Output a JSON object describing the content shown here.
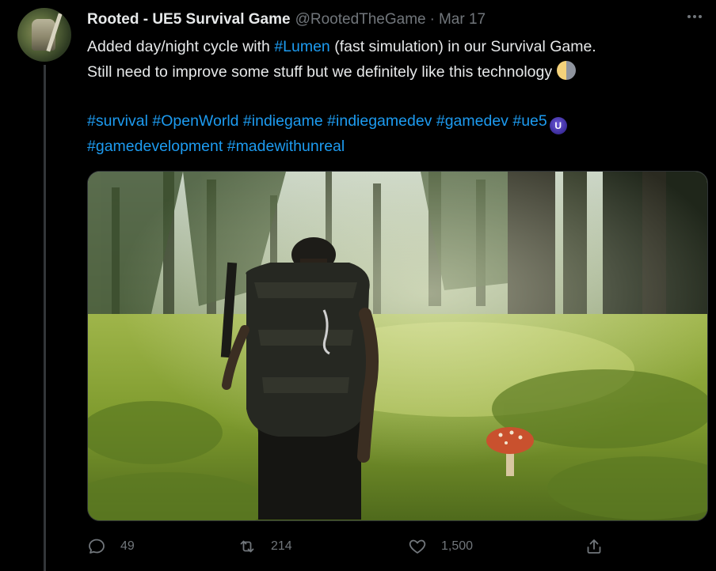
{
  "tweet": {
    "author_name": "Rooted - UE5 Survival Game",
    "handle": "@RootedTheGame",
    "separator": "·",
    "date": "Mar 17",
    "text_line1_before": "Added day/night cycle with ",
    "text_line1_tag": "#Lumen",
    "text_line1_after": " (fast simulation) in our Survival Game.",
    "text_line2": "Still need to improve some stuff but we definitely like this technology",
    "hashtags_line1": [
      "#survival",
      "#OpenWorld",
      "#indiegame",
      "#indiegamedev",
      "#gamedev",
      "#ue5"
    ],
    "hashtags_line2": [
      "#gamedevelopment",
      "#madewithunreal"
    ],
    "moon_emoji": "half-moon-emoji",
    "ue_badge_icon": "unreal-engine-icon",
    "ue_badge_glyph": "U"
  },
  "actions": {
    "reply_count": "49",
    "retweet_count": "214",
    "like_count": "1,500",
    "reply_icon": "reply-icon",
    "retweet_icon": "retweet-icon",
    "like_icon": "heart-icon",
    "share_icon": "share-icon"
  },
  "colors": {
    "background": "#000000",
    "text": "#e7e9ea",
    "muted": "#71767b",
    "link": "#1d9bf0"
  }
}
